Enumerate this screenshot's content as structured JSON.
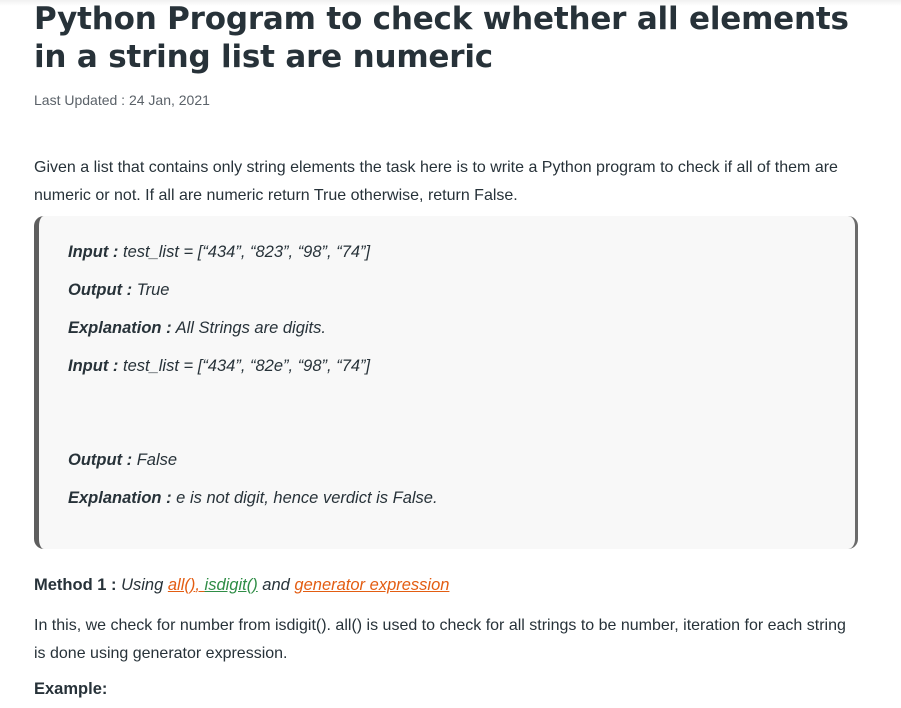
{
  "article": {
    "title": "Python Program to check whether all elements in a string list are numeric",
    "last_updated": "Last Updated : 24 Jan, 2021",
    "intro": "Given a list that contains only string elements the task here is to write a Python program to check if all of them are numeric or not. If all are numeric return True otherwise, return False."
  },
  "example_box": {
    "lines": [
      {
        "label": "Input :",
        "text": " test_list = [“434”, “823”, “98”, “74”]"
      },
      {
        "label": "Output :",
        "text": " True"
      },
      {
        "label": "Explanation :",
        "text": " All Strings are digits."
      },
      {
        "label": "Input :",
        "text": " test_list = [“434”, “82e”, “98”, “74”]"
      },
      {
        "label": "Output :",
        "text": " False"
      },
      {
        "label": "Explanation :",
        "text": " e is not digit, hence verdict is False."
      }
    ]
  },
  "method1": {
    "label": "Method 1 :",
    "using": " Using ",
    "link_all": "all()",
    "comma": ", ",
    "link_isdigit": "isdigit()",
    "and": " and ",
    "link_generator": "generator expression",
    "description": "In this, we check for number from isdigit(). all() is used to check for all strings to be number, iteration for each string is done using generator expression.",
    "example_label": "Example:"
  },
  "colors": {
    "link_orange": "#e35d12",
    "link_green": "#2f8d46",
    "text": "#273239",
    "box_bg": "#f8f8f8"
  }
}
